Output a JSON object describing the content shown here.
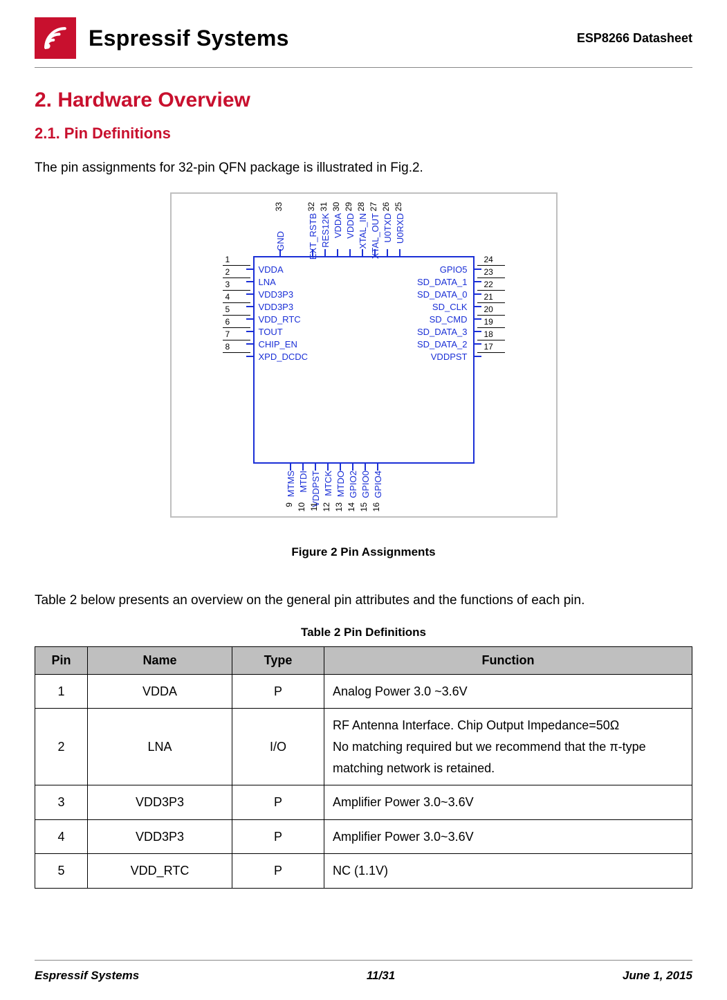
{
  "header": {
    "company": "Espressif Systems",
    "doc_id": "ESP8266  Datasheet"
  },
  "sections": {
    "h2": "2.     Hardware Overview",
    "h3": "2.1.     Pin Definitions",
    "intro": "The pin assignments for 32-pin QFN package is illustrated in Fig.2.",
    "fig_caption": "Figure 2   Pin Assignments",
    "table_intro": "Table 2 below presents an overview on the general pin attributes and the functions of each pin.",
    "table_title": "Table 2 Pin Definitions"
  },
  "pinout": {
    "gnd": {
      "num": "33",
      "label": "GND"
    },
    "top": [
      {
        "num": "32",
        "label": "EXT_RSTB"
      },
      {
        "num": "31",
        "label": "RES12K"
      },
      {
        "num": "30",
        "label": "VDDA"
      },
      {
        "num": "29",
        "label": "VDDD"
      },
      {
        "num": "28",
        "label": "XTAL_IN"
      },
      {
        "num": "27",
        "label": "XTAL_OUT"
      },
      {
        "num": "26",
        "label": "U0TXD"
      },
      {
        "num": "25",
        "label": "U0RXD"
      }
    ],
    "left": [
      {
        "num": "1",
        "label": "VDDA"
      },
      {
        "num": "2",
        "label": "LNA"
      },
      {
        "num": "3",
        "label": "VDD3P3"
      },
      {
        "num": "4",
        "label": "VDD3P3"
      },
      {
        "num": "5",
        "label": "VDD_RTC"
      },
      {
        "num": "6",
        "label": "TOUT"
      },
      {
        "num": "7",
        "label": "CHIP_EN"
      },
      {
        "num": "8",
        "label": "XPD_DCDC"
      }
    ],
    "right": [
      {
        "num": "24",
        "label": "GPIO5"
      },
      {
        "num": "23",
        "label": "SD_DATA_1"
      },
      {
        "num": "22",
        "label": "SD_DATA_0"
      },
      {
        "num": "21",
        "label": "SD_CLK"
      },
      {
        "num": "20",
        "label": "SD_CMD"
      },
      {
        "num": "19",
        "label": "SD_DATA_3"
      },
      {
        "num": "18",
        "label": "SD_DATA_2"
      },
      {
        "num": "17",
        "label": "VDDPST"
      }
    ],
    "bottom": [
      {
        "num": "9",
        "label": "MTMS"
      },
      {
        "num": "10",
        "label": "MTDI"
      },
      {
        "num": "11",
        "label": "VDDPST"
      },
      {
        "num": "12",
        "label": "MTCK"
      },
      {
        "num": "13",
        "label": "MTDO"
      },
      {
        "num": "14",
        "label": "GPIO2"
      },
      {
        "num": "15",
        "label": "GPIO0"
      },
      {
        "num": "16",
        "label": "GPIO4"
      }
    ]
  },
  "table": {
    "headers": {
      "pin": "Pin",
      "name": "Name",
      "type": "Type",
      "function": "Function"
    },
    "rows": [
      {
        "pin": "1",
        "name": "VDDA",
        "type": "P",
        "function": "Analog Power 3.0 ~3.6V"
      },
      {
        "pin": "2",
        "name": "LNA",
        "type": "I/O",
        "function": "RF Antenna Interface. Chip Output Impedance=50Ω\nNo matching required but we recommend that the π-type matching network is retained."
      },
      {
        "pin": "3",
        "name": "VDD3P3",
        "type": "P",
        "function": "Amplifier Power 3.0~3.6V"
      },
      {
        "pin": "4",
        "name": "VDD3P3",
        "type": "P",
        "function": "Amplifier Power 3.0~3.6V"
      },
      {
        "pin": "5",
        "name": "VDD_RTC",
        "type": "P",
        "function": "NC (1.1V)"
      }
    ]
  },
  "footer": {
    "left": "Espressif Systems",
    "center": "11/31",
    "right": "June 1, 2015"
  }
}
